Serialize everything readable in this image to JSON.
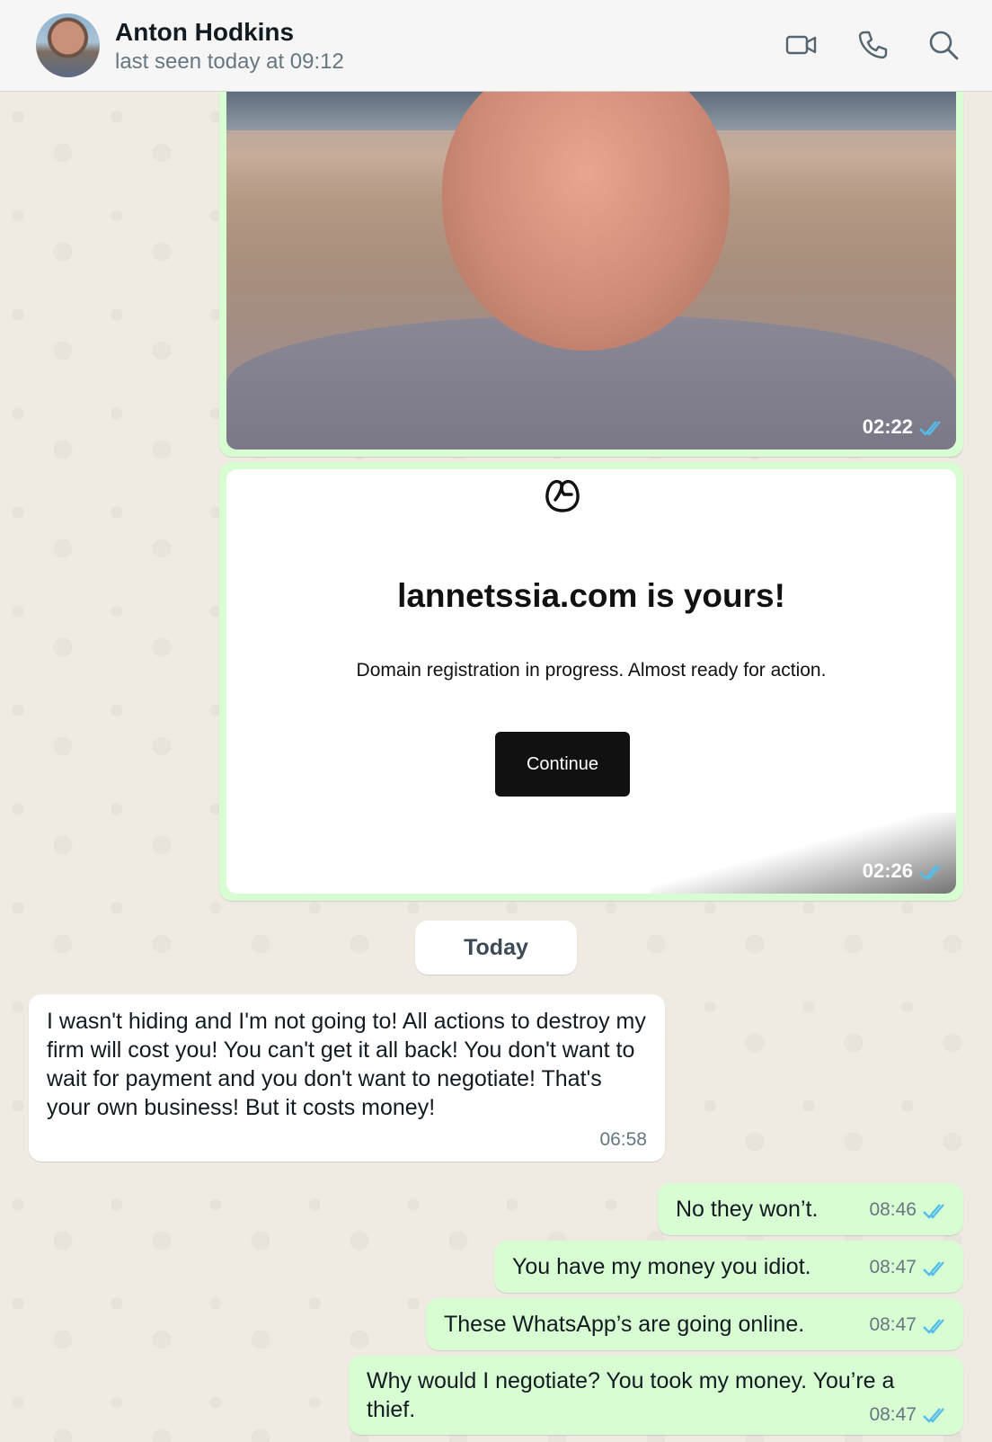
{
  "header": {
    "contact_name": "Anton Hodkins",
    "contact_status": "last seen today at 09:12",
    "icons": [
      "video-call-icon",
      "phone-icon",
      "search-icon"
    ]
  },
  "messages": {
    "photo": {
      "time": "02:22"
    },
    "card": {
      "title": "lannetssia.com is yours!",
      "subtitle": "Domain registration in progress. Almost ready for action.",
      "button_label": "Continue",
      "time": "02:26"
    },
    "date_divider": "Today",
    "incoming": {
      "text": "I wasn't hiding and I'm not going to! All actions to destroy my firm will cost you! You can't get it all back! You don't want to wait for payment and you don't want to negotiate! That's your own business! But it costs money!",
      "time": "06:58"
    },
    "outgoing": [
      {
        "text": "No they won’t.",
        "time": "08:46"
      },
      {
        "text": "You have my money you idiot.",
        "time": "08:47"
      },
      {
        "text": "These WhatsApp’s are going online.",
        "time": "08:47"
      },
      {
        "text": "Why would I negotiate? You took my money. You’re a thief.",
        "time": "08:47"
      }
    ]
  },
  "colors": {
    "outgoing_bubble": "#d9fdd3",
    "incoming_bubble": "#ffffff",
    "read_ticks": "#53bdeb",
    "chat_background": "#efeae2"
  }
}
